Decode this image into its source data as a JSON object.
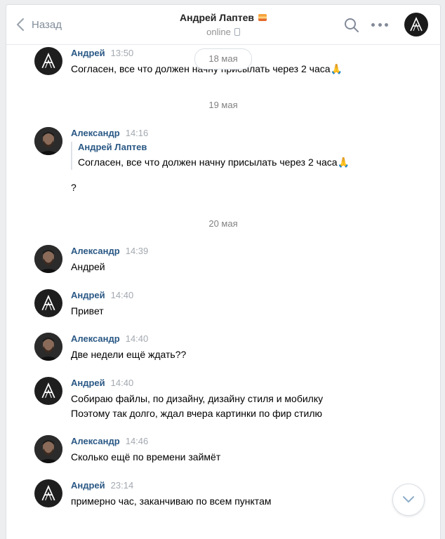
{
  "header": {
    "back_label": "Назад",
    "title": "Андрей Лаптев",
    "status": "online"
  },
  "date_pill": "18 мая",
  "dates": [
    "19 мая",
    "20 мая"
  ],
  "messages": [
    {
      "author": "Андрей",
      "time": "13:50",
      "text": "Согласен, все что должен начну присылать через 2 часа🙏",
      "avatar": "logo"
    },
    {
      "author": "Александр",
      "time": "14:16",
      "quote_author": "Андрей Лаптев",
      "quote_text": "Согласен, все что должен начну присылать через 2 часа🙏",
      "text": "?",
      "avatar": "photo"
    },
    {
      "author": "Александр",
      "time": "14:39",
      "text": "Андрей",
      "avatar": "photo"
    },
    {
      "author": "Андрей",
      "time": "14:40",
      "text": "Привет",
      "avatar": "logo"
    },
    {
      "author": "Александр",
      "time": "14:40",
      "text": "Две недели ещё ждать??",
      "avatar": "photo"
    },
    {
      "author": "Андрей",
      "time": "14:40",
      "lines": [
        "Собираю файлы, по дизайну, дизайну стиля и мобилку",
        "Поэтому так долго, ждал вчера картинки по фир стилю"
      ],
      "avatar": "logo"
    },
    {
      "author": "Александр",
      "time": "14:46",
      "text": "Сколько ещё по времени займёт",
      "avatar": "photo"
    },
    {
      "author": "Андрей",
      "time": "23:14",
      "text": "примерно час, заканчиваю по всем пунктам",
      "avatar": "logo"
    }
  ],
  "icons": {
    "back": "chevron-left-icon",
    "search": "search-icon",
    "more": "more-dots-icon",
    "scroll_down": "chevron-down-icon"
  },
  "colors": {
    "link": "#2a5885",
    "muted": "#828282",
    "background": "#edeef0"
  }
}
